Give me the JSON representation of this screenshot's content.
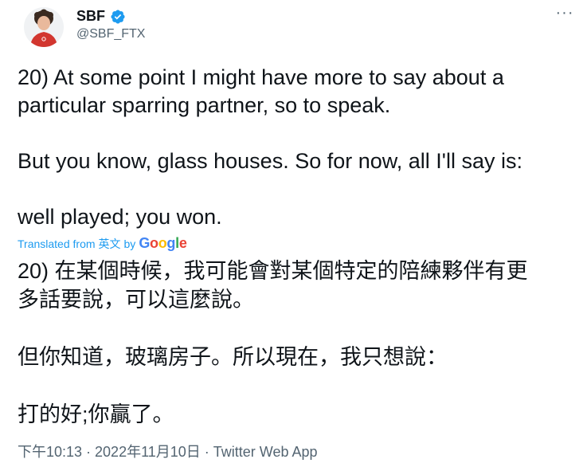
{
  "author": {
    "display_name": "SBF",
    "handle": "@SBF_FTX"
  },
  "tweet": {
    "text": "20) At some point I might have more to say about a\nparticular sparring partner, so to speak.\n\nBut you know, glass houses.  So for now, all I'll say is:\n\nwell played; you won."
  },
  "translation": {
    "label_prefix": "Translated from",
    "language": "英文",
    "label_by": "by",
    "provider_letters": [
      "G",
      "o",
      "o",
      "g",
      "l",
      "e"
    ],
    "text": "20) 在某個時候，我可能會對某個特定的陪練夥伴有更\n多話要說，可以這麼說。\n\n但你知道，玻璃房子。所以現在，我只想說：\n\n打的好;你贏了。"
  },
  "meta": {
    "timestamp": "下午10:13 · 2022年11月10日 · Twitter Web App"
  },
  "colors": {
    "verified_badge": "#1d9bf0",
    "link": "#1d9bf0",
    "secondary_text": "#536471"
  }
}
